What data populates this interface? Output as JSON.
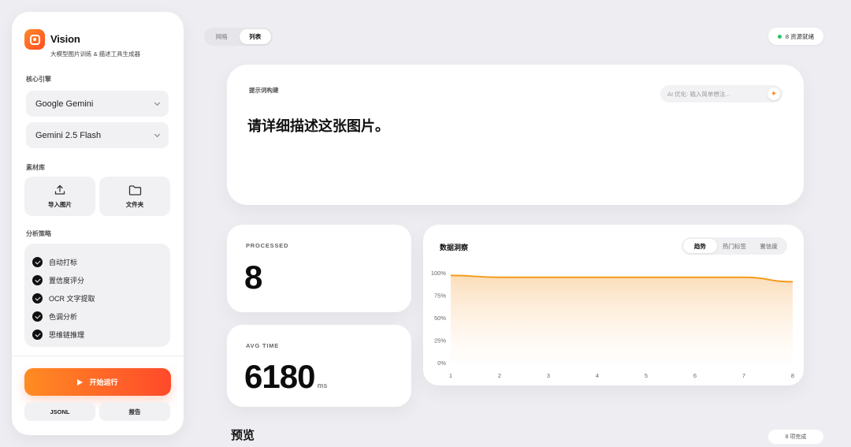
{
  "sidebar": {
    "app_title": "Vision",
    "app_subtitle": "大模型图片训练 & 描述工具生成器",
    "engine_label": "核心引擎",
    "provider_select": "Google Gemini",
    "model_select": "Gemini 2.5 Flash",
    "library_label": "素材库",
    "import_label": "导入图片",
    "folder_label": "文件夹",
    "strategy_label": "分析策略",
    "strategies": [
      {
        "label": "自动打标",
        "checked": true
      },
      {
        "label": "置信度评分",
        "checked": true
      },
      {
        "label": "OCR 文字提取",
        "checked": true
      },
      {
        "label": "色调分析",
        "checked": true
      },
      {
        "label": "思维链推理",
        "checked": true
      }
    ],
    "run_label": "开始运行",
    "jsonl_label": "JSONL",
    "report_label": "报告"
  },
  "topbar": {
    "view_grid": "网格",
    "view_list": "列表",
    "status_text": "8 资源就绪",
    "status_color": "#2ec265"
  },
  "prompt": {
    "label": "提示词构建",
    "text": "请详细描述这张图片。",
    "ai_placeholder": "AI 优化: 输入简单想法..."
  },
  "stats": {
    "processed_label": "PROCESSED",
    "processed_value": "8",
    "avg_label": "AVG TIME",
    "avg_value": "6180",
    "avg_unit": "ms"
  },
  "insights": {
    "title": "数据洞察",
    "tabs": [
      "趋势",
      "热门标签",
      "置信度"
    ],
    "active_tab": "趋势"
  },
  "chart_data": {
    "type": "area",
    "x": [
      1,
      2,
      3,
      4,
      5,
      6,
      7,
      8
    ],
    "values": [
      97,
      95,
      95,
      95,
      95,
      95,
      95,
      90
    ],
    "y_ticks": [
      "100%",
      "75%",
      "50%",
      "25%",
      "0%"
    ],
    "ylim": [
      0,
      100
    ],
    "color": "#f59a1a",
    "grid": false
  },
  "preview": {
    "title": "预览",
    "pill": "8 项完成"
  },
  "colors": {
    "accent_start": "#ff8b22",
    "accent_end": "#ff4a2b"
  }
}
